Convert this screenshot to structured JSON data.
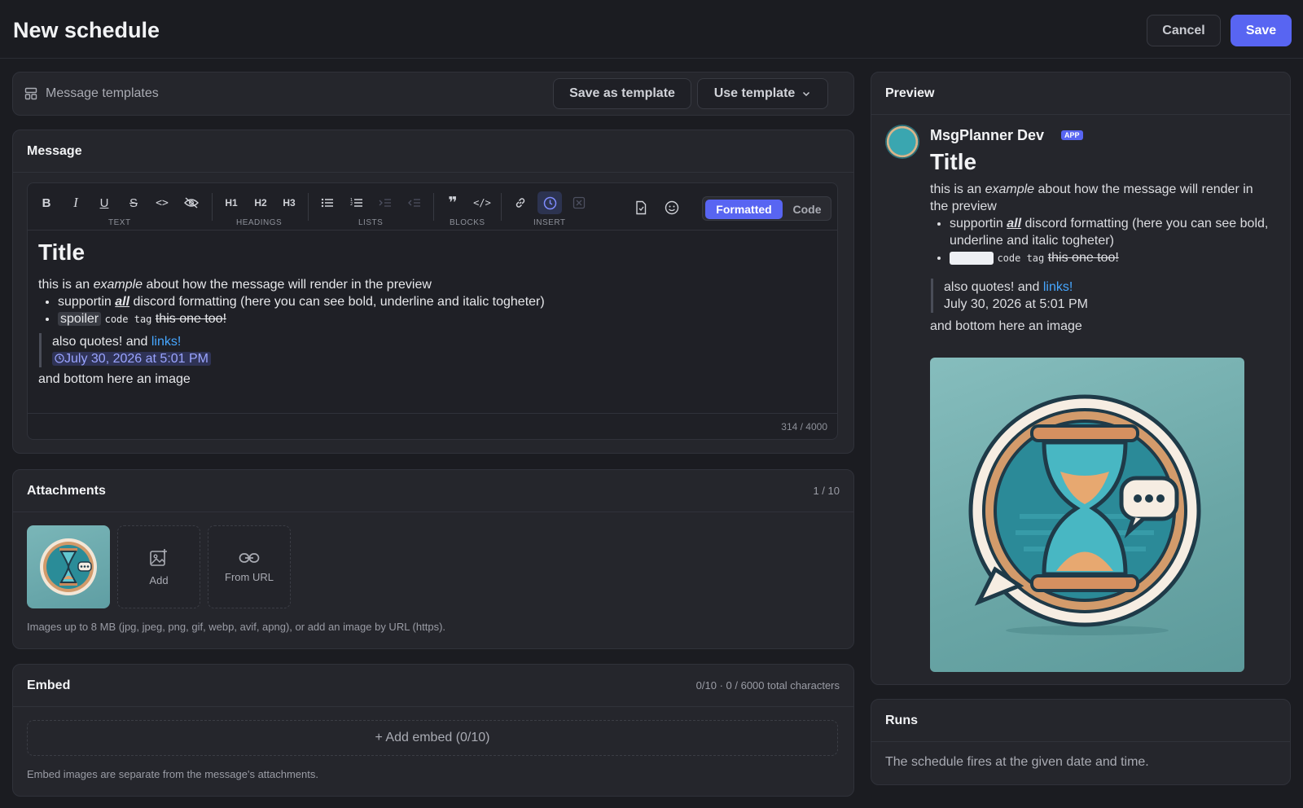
{
  "header": {
    "title": "New schedule",
    "cancel_label": "Cancel",
    "save_label": "Save"
  },
  "templates": {
    "label": "Message templates",
    "save_as_template": "Save as template",
    "use_template": "Use template"
  },
  "message": {
    "section_title": "Message",
    "toolbar_groups": [
      "TEXT",
      "HEADINGS",
      "LISTS",
      "BLOCKS",
      "INSERT"
    ],
    "heading_buttons": [
      "H1",
      "H2",
      "H3"
    ],
    "mode_formatted": "Formatted",
    "mode_code": "Code",
    "content": {
      "title": "Title",
      "intro_before": "this is an ",
      "intro_em": "example",
      "intro_after": " about how the message will render in the preview",
      "bullet1_before": "supportin ",
      "bullet1_strong": "all",
      "bullet1_after": " discord formatting (here you can see bold, underline and italic togheter)",
      "spoiler": "spoiler",
      "code": "code tag",
      "strike": "this one too!",
      "quote_text": "also quotes! and ",
      "quote_link": "links!",
      "timestamp": "July 30, 2026 at 5:01 PM",
      "bottom": "and bottom here an image"
    },
    "counter": "314 / 4000"
  },
  "attachments": {
    "section_title": "Attachments",
    "count": "1 / 10",
    "add_label": "Add",
    "from_url_label": "From URL",
    "note": "Images up to 8 MB (jpg, jpeg, png, gif, webp, avif, apng), or add an image by URL (https)."
  },
  "embed": {
    "section_title": "Embed",
    "count": "0/10 · 0 / 6000 total characters",
    "add_label": "+ Add embed (0/10)",
    "note": "Embed images are separate from the message's attachments."
  },
  "preview": {
    "section_title": "Preview",
    "bot_name": "MsgPlanner Dev",
    "badge": "APP",
    "title": "Title",
    "intro_before": "this is an ",
    "intro_em": "example",
    "intro_after": " about how the message will render in the preview",
    "bullet1_before": "supportin ",
    "bullet1_strong": "all",
    "bullet1_after": " discord formatting (here you can see bold, underline and italic togheter)",
    "code": "code tag",
    "strike": "this one too!",
    "quote_text": "also quotes! and ",
    "quote_link": "links!",
    "timestamp": "July 30, 2026 at 5:01 PM",
    "bottom": "and bottom here an image"
  },
  "runs": {
    "section_title": "Runs",
    "text": "The schedule fires at the given date and time."
  },
  "colors": {
    "accent": "#5865f2",
    "link": "#46a6ff",
    "background": "#1b1c21",
    "panel": "#25262c"
  }
}
